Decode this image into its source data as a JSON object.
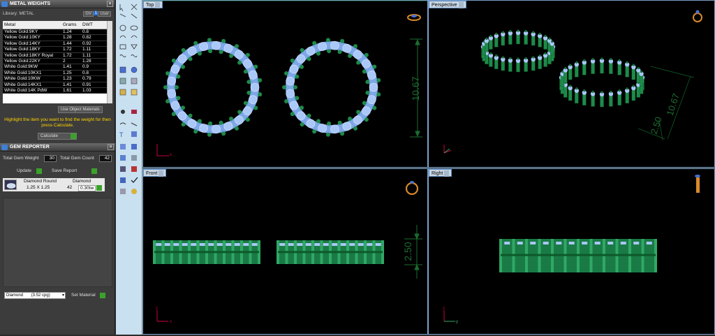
{
  "metal_weights": {
    "title": "METAL WEIGHTS",
    "library_label": "Library: METAL",
    "gv_label": "GV",
    "gv_value": "1",
    "user_label": "User",
    "columns": [
      "Metal",
      "Grams",
      "DWT"
    ],
    "rows": [
      [
        "Yellow Gold:9KY",
        "1.24",
        "0.8"
      ],
      [
        "Yellow Gold:10KY",
        "1.28",
        "0.82"
      ],
      [
        "Yellow Gold:14KY",
        "1.44",
        "0.92"
      ],
      [
        "Yellow Gold:18KY",
        "1.72",
        "1.11"
      ],
      [
        "Yellow Gold:18KY Royal",
        "1.72",
        "1.11"
      ],
      [
        "Yellow Gold:22KY",
        "2",
        "1.28"
      ],
      [
        "White Gold:9KW",
        "1.41",
        "0.9"
      ],
      [
        "White Gold:10KX1",
        "1.25",
        "0.8"
      ],
      [
        "White Gold:10KW",
        "1.23",
        "0.79"
      ],
      [
        "White Gold:14KX1",
        "1.41",
        "0.91"
      ],
      [
        "White Gold:14K PdW",
        "1.61",
        "1.03"
      ]
    ],
    "use_object_materials": "Use Object Materials",
    "hint": "Highlight the item you want to find the weight for then press Calculate.",
    "calculate": "Calculate"
  },
  "gem_reporter": {
    "title": "GEM REPORTER",
    "total_weight_label": "Total Gem Weight",
    "total_weight_value": "30",
    "total_count_label": "Total Gem Count",
    "total_count_value": "42",
    "update": "Update",
    "save_report": "Save Report",
    "gem": {
      "shape": "Diamond Round",
      "size": "1.25 X 1.25",
      "material": "Diamond",
      "count": "42",
      "weight": "0.30tw"
    },
    "material_select": "Diamond",
    "material_value": "(3.52 cpg)",
    "set_material": "Set Material"
  },
  "viewports": {
    "top": "Top",
    "perspective": "Perspective",
    "front": "Front",
    "right": "Right"
  },
  "dimensions": {
    "top_height": "10.67",
    "persp_a": "10.67",
    "persp_b": "2.50",
    "front_height": "2.50"
  },
  "axis": {
    "x": "x",
    "y": "y",
    "z": "z"
  },
  "colors": {
    "ring": "#1e8a4a",
    "gem": "#a9c7f7",
    "dim": "#1b6c2f",
    "hint": "#ffd400"
  }
}
